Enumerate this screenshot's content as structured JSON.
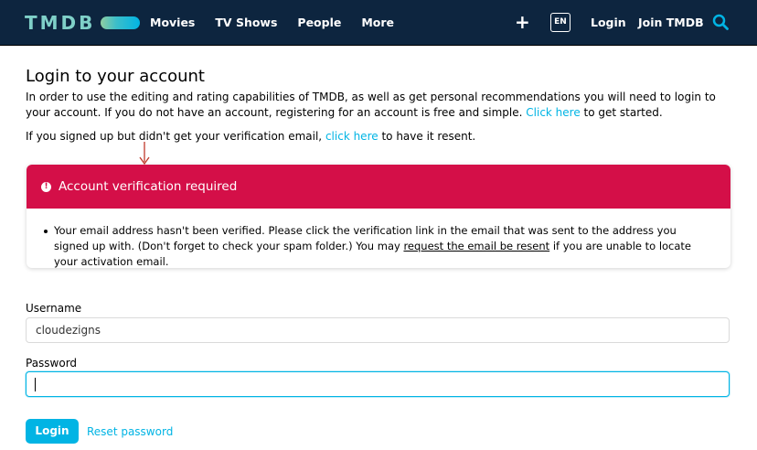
{
  "header": {
    "logo_text": "TMDB",
    "nav": [
      "Movies",
      "TV Shows",
      "People",
      "More"
    ],
    "add_icon": "plus-icon",
    "language": "EN",
    "login_label": "Login",
    "join_label": "Join TMDB",
    "search_icon": "search-icon",
    "background": "#0d253f"
  },
  "page": {
    "title": "Login to your account",
    "intro_text": "In order to use the editing and rating capabilities of TMDB, as well as get personal recommendations you will need to login to your account. If you do not have an account, registering for an account is free and simple.",
    "intro_link": "Click here",
    "intro_suffix": "to get started.",
    "resend_prefix": "If you signed up but didn't get your verification email,",
    "resend_link": "click here",
    "resend_suffix": "to have it resent."
  },
  "alert": {
    "title": "Account verification required",
    "icon": "exclamation-icon",
    "color": "#d40f48",
    "body_prefix": "Your email address hasn't been verified. Please click the verification link in the email that was sent to the address you signed up with. (Don't forget to check your spam folder.) You may",
    "body_link": "request the email be resent",
    "body_suffix": "if you are unable to locate your activation email."
  },
  "form": {
    "username_label": "Username",
    "username_value": "cloudezigns",
    "password_label": "Password",
    "password_value": "",
    "login_button": "Login",
    "reset_link": "Reset password",
    "accent": "#01b4e4"
  }
}
